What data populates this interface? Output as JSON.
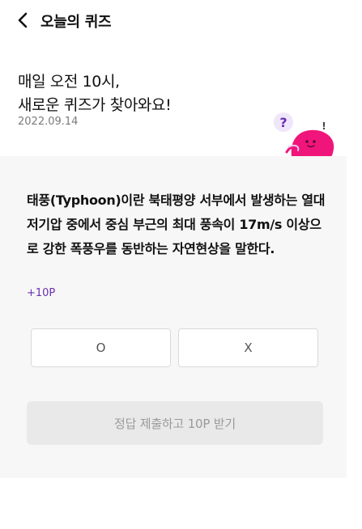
{
  "header": {
    "title": "오늘의 퀴즈"
  },
  "hero": {
    "line1": "매일 오전 10시,",
    "line2": "새로운 퀴즈가 찾아와요!",
    "date": "2022.09.14",
    "mascot_question_mark": "?",
    "mascot_exclamation": "!"
  },
  "quiz": {
    "question": "태풍(Typhoon)이란 북태평양 서부에서 발생하는 열대 저기압 중에서 중심 부근의 최대 풍속이 17m/s 이상으로 강한 폭풍우를 동반하는 자연현상을 말한다.",
    "points": "+10P",
    "option_o": "O",
    "option_x": "X",
    "submit_label": "정답 제출하고 10P 받기"
  },
  "colors": {
    "accent_purple": "#6a2fb3",
    "mascot_pink": "#f0157a",
    "panel_bg": "#f7f7f7"
  }
}
